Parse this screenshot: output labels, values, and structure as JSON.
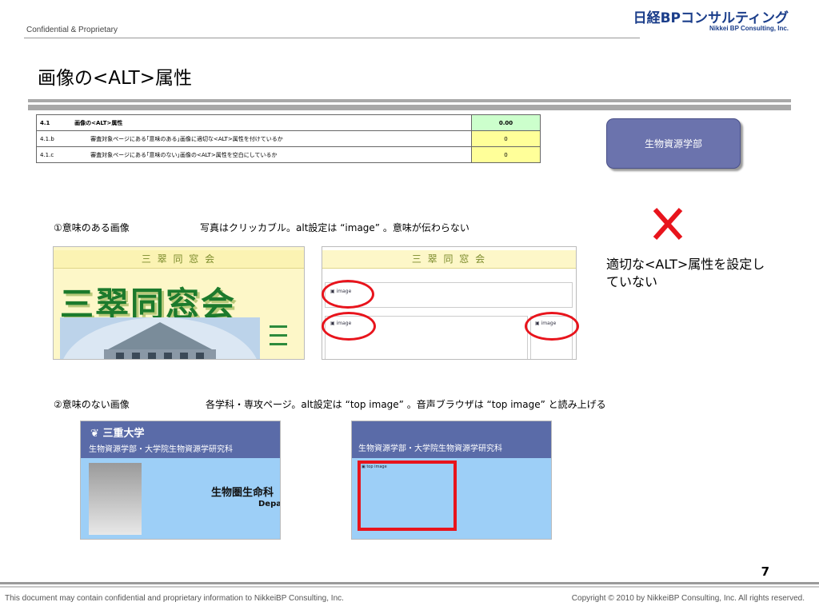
{
  "header": {
    "confidential": "Confidential & Proprietary",
    "logo_jp": "日経BPコンサルティング",
    "logo_en": "Nikkei BP Consulting, Inc."
  },
  "title": "画像の<ALT>属性",
  "criteria_table": [
    {
      "num": "4.1",
      "desc": "画像の<ALT>属性",
      "value": "0.00"
    },
    {
      "num": "4.1.b",
      "desc": "審査対象ページにある｢意味のある｣画像に適切な<ALT>属性を付けているか",
      "value": "0"
    },
    {
      "num": "4.1.c",
      "desc": "審査対象ページにある｢意味のない｣画像の<ALT>属性を空白にしているか",
      "value": "0"
    }
  ],
  "department": "生物資源学部",
  "verdict": {
    "icon": "cross-mark-icon",
    "text": "適切な<ALT>属性を設定していない"
  },
  "section1": {
    "label": "①意味のある画像",
    "caption": "写真はクリッカブル。alt設定は “image” 。意味が伝わらない",
    "site_title": "三 翠 同 窓 会",
    "site_logo": "三翠同窓会",
    "broken_image_alt": "image"
  },
  "section2": {
    "label": "②意味のない画像",
    "caption": "各学科・専攻ページ。alt設定は “top image” 。音声ブラウザは “top image” と読み上げる",
    "univ_name": "三重大学",
    "banner_text": "生物資源学部・大学院生物資源学研究科",
    "heading_text": "生物圏生命科",
    "heading_sub": "Depa",
    "broken_image_alt": "top image"
  },
  "page_number": "7",
  "footer": {
    "left": "This document may contain confidential and proprietary information to NikkeiBP Consulting, Inc.",
    "right": "Copyright © 2010 by NikkeiBP Consulting, Inc. All rights reserved."
  },
  "colors": {
    "highlight_circle": "#e8141c",
    "highlight_box": "#e8141c",
    "department_box": "#6b73ad",
    "site_banner": "#5a6ba8",
    "site_background": "#9dcff7"
  }
}
